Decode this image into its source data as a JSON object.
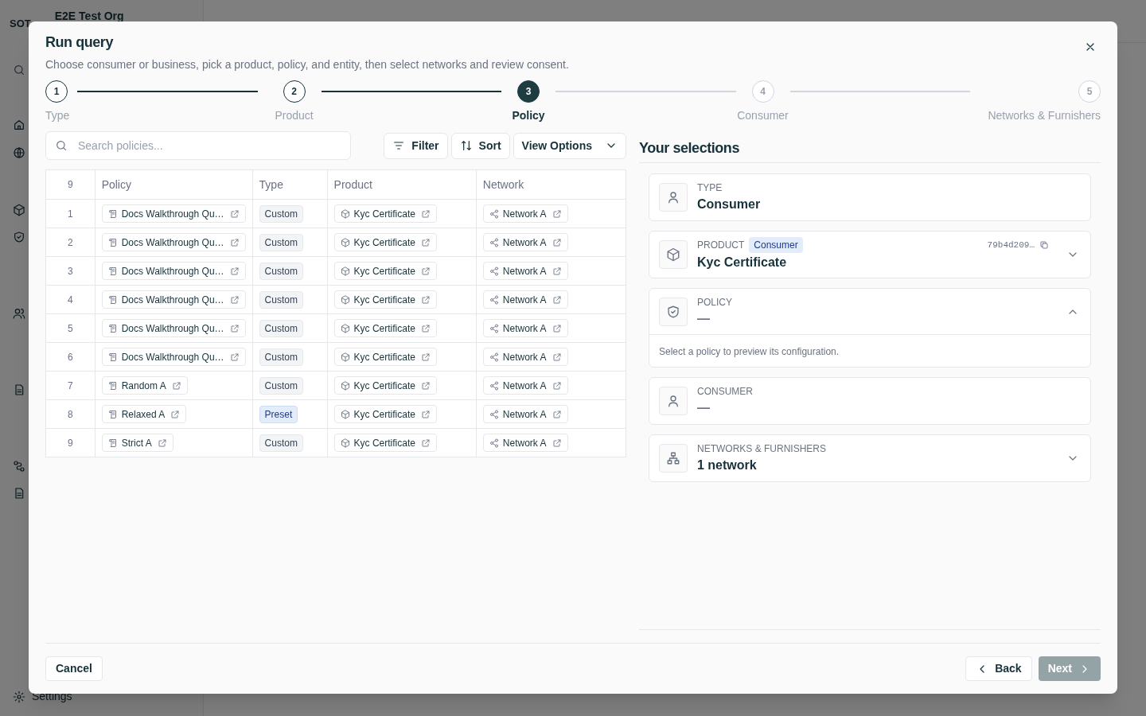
{
  "app": {
    "brand": "SOT",
    "org": "E2E Test Org",
    "settings": "Settings"
  },
  "dialog": {
    "title": "Run query",
    "subtitle": "Choose consumer or business, pick a product, policy, and entity, then select networks and review consent.",
    "steps": [
      {
        "number": "1",
        "label": "Type",
        "done": true,
        "selected": false
      },
      {
        "number": "2",
        "label": "Product",
        "done": true,
        "selected": false
      },
      {
        "number": "3",
        "label": "Policy",
        "done": false,
        "selected": true
      },
      {
        "number": "4",
        "label": "Consumer",
        "done": false,
        "selected": false
      },
      {
        "number": "5",
        "label": "Networks & Furnishers",
        "done": false,
        "selected": false
      }
    ],
    "search": {
      "placeholder": "Search policies..."
    },
    "toolbar": {
      "filter": "Filter",
      "sort": "Sort",
      "view_options": "View Options"
    },
    "table": {
      "count": "9",
      "columns": [
        "Policy",
        "Type",
        "Product",
        "Network"
      ],
      "rows": [
        {
          "index": "1",
          "policy": "Docs Walkthrough Qu…",
          "type": "Custom",
          "kind": "custom",
          "product": "Kyc Certificate",
          "network": "Network A"
        },
        {
          "index": "2",
          "policy": "Docs Walkthrough Qu…",
          "type": "Custom",
          "kind": "custom",
          "product": "Kyc Certificate",
          "network": "Network A"
        },
        {
          "index": "3",
          "policy": "Docs Walkthrough Qu…",
          "type": "Custom",
          "kind": "custom",
          "product": "Kyc Certificate",
          "network": "Network A"
        },
        {
          "index": "4",
          "policy": "Docs Walkthrough Qu…",
          "type": "Custom",
          "kind": "custom",
          "product": "Kyc Certificate",
          "network": "Network A"
        },
        {
          "index": "5",
          "policy": "Docs Walkthrough Qu…",
          "type": "Custom",
          "kind": "custom",
          "product": "Kyc Certificate",
          "network": "Network A"
        },
        {
          "index": "6",
          "policy": "Docs Walkthrough Qu…",
          "type": "Custom",
          "kind": "custom",
          "product": "Kyc Certificate",
          "network": "Network A"
        },
        {
          "index": "7",
          "policy": "Random A",
          "type": "Custom",
          "kind": "custom",
          "product": "Kyc Certificate",
          "network": "Network A"
        },
        {
          "index": "8",
          "policy": "Relaxed A",
          "type": "Preset",
          "kind": "preset",
          "product": "Kyc Certificate",
          "network": "Network A"
        },
        {
          "index": "9",
          "policy": "Strict A",
          "type": "Custom",
          "kind": "custom",
          "product": "Kyc Certificate",
          "network": "Network A"
        }
      ]
    },
    "selections": {
      "title": "Your selections",
      "cards": [
        {
          "kind": "type",
          "label": "TYPE",
          "value": "Consumer",
          "empty": false
        },
        {
          "kind": "product",
          "label": "PRODUCT",
          "badge": "Consumer",
          "id": "79b4d209…",
          "value": "Kyc Certificate",
          "empty": false,
          "expanded": false
        },
        {
          "kind": "policy",
          "label": "POLICY",
          "value": "—",
          "empty": true,
          "expanded": true,
          "note": "Select a policy to preview its configuration."
        },
        {
          "kind": "consumer",
          "label": "CONSUMER",
          "value": "—",
          "empty": true
        },
        {
          "kind": "networks",
          "label": "NETWORKS & FURNISHERS",
          "value": "1 network",
          "empty": false,
          "expanded": false
        }
      ]
    },
    "buttons": {
      "cancel": "Cancel",
      "back": "Back",
      "next": "Next",
      "next_disabled": true
    }
  }
}
